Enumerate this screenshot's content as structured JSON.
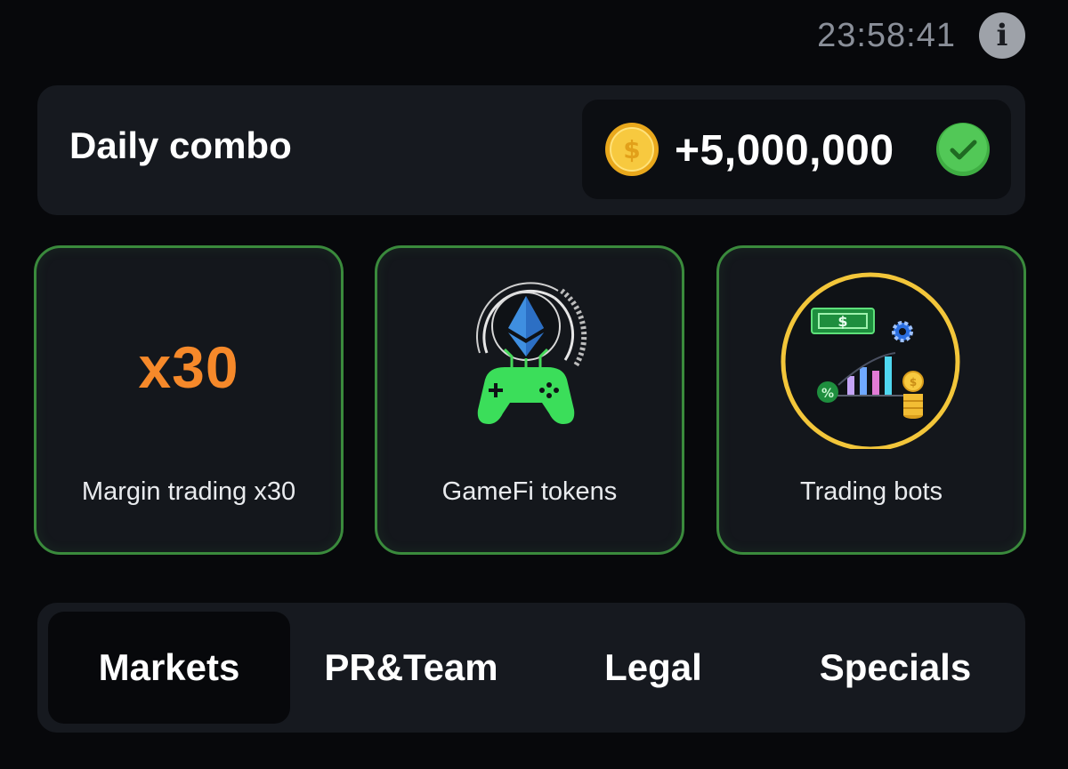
{
  "header": {
    "timer": "23:58:41",
    "info_icon": "info-icon"
  },
  "combo": {
    "title": "Daily combo",
    "reward": "+5,000,000",
    "coin_icon": "coin-icon",
    "status_icon": "check-icon"
  },
  "cards": [
    {
      "badge": "x30",
      "label": "Margin trading x30",
      "icon": "x30-badge"
    },
    {
      "label": "GameFi tokens",
      "icon": "gamefi-icon"
    },
    {
      "label": "Trading bots",
      "icon": "trading-bots-icon"
    }
  ],
  "tabs": [
    {
      "label": "Markets",
      "active": true
    },
    {
      "label": "PR&Team",
      "active": false
    },
    {
      "label": "Legal",
      "active": false
    },
    {
      "label": "Specials",
      "active": false
    }
  ],
  "colors": {
    "accent_green": "#3a8a3c",
    "coin_gold": "#f4c23b",
    "badge_orange": "#f6892a",
    "check_green": "#45c24a"
  }
}
